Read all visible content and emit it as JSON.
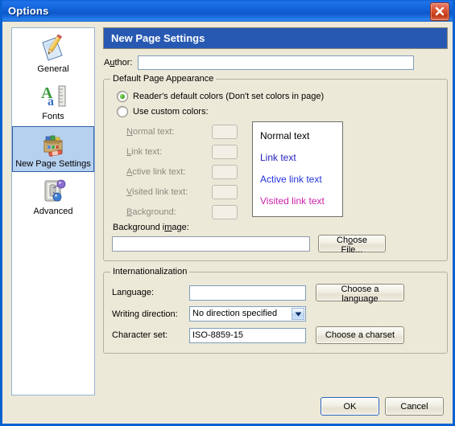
{
  "window": {
    "title": "Options",
    "close_icon": "close-icon"
  },
  "sidebar": {
    "items": [
      {
        "label": "General",
        "icon": "page-pencil-icon",
        "selected": false
      },
      {
        "label": "Fonts",
        "icon": "font-ruler-icon",
        "selected": false
      },
      {
        "label": "New Page Settings",
        "icon": "crayon-box-icon",
        "selected": true
      },
      {
        "label": "Advanced",
        "icon": "switch-nodes-icon",
        "selected": false
      }
    ]
  },
  "pane": {
    "header": "New Page Settings",
    "author": {
      "label_pre": "A",
      "label_accel": "u",
      "label_post": "thor:",
      "value": "",
      "placeholder": ""
    },
    "appearance": {
      "legend": "Default Page Appearance",
      "radio_default": "Reader's default colors (Don't set colors in page)",
      "radio_custom": "Use custom colors:",
      "selected_option": "default",
      "color_rows": [
        {
          "accel": "N",
          "rest": "ormal text:",
          "swatch_color": "#f2f0e6",
          "enabled": false
        },
        {
          "accel": "L",
          "rest": "ink text:",
          "swatch_color": "#f2f0e6",
          "enabled": false
        },
        {
          "accel": "A",
          "rest": "ctive link text:",
          "swatch_color": "#f2f0e6",
          "enabled": false
        },
        {
          "accel": "V",
          "rest": "isited link text:",
          "swatch_color": "#f2f0e6",
          "enabled": false
        },
        {
          "accel": "B",
          "rest": "ackground:",
          "swatch_color": "#f2f0e6",
          "enabled": false
        }
      ],
      "preview": [
        {
          "text": "Normal text",
          "color": "#000000"
        },
        {
          "text": "Link text",
          "color": "#2222bb"
        },
        {
          "text": "Active link text",
          "color": "#2233dd"
        },
        {
          "text": "Visited link text",
          "color": "#cc22aa"
        }
      ],
      "preview_background": "#ffffff",
      "background_image": {
        "label_pre": "Background i",
        "label_accel": "m",
        "label_post": "age:",
        "value": "",
        "button_pre": "Ch",
        "button_accel": "o",
        "button_post": "ose File..."
      }
    },
    "internationalization": {
      "legend": "Internationalization",
      "language": {
        "label": "Language:",
        "value": "",
        "button": "Choose a language"
      },
      "writing_direction": {
        "label": "Writing direction:",
        "value": "No direction specified"
      },
      "charset": {
        "label": "Character set:",
        "value": "ISO-8859-15",
        "button": "Choose a charset"
      }
    }
  },
  "footer": {
    "ok": "OK",
    "cancel": "Cancel"
  },
  "theme": {
    "titlebar_blue": "#1667de",
    "header_blue": "#2759b3",
    "dialog_face": "#ece9d8",
    "selection_blue": "#b6d1f0"
  }
}
